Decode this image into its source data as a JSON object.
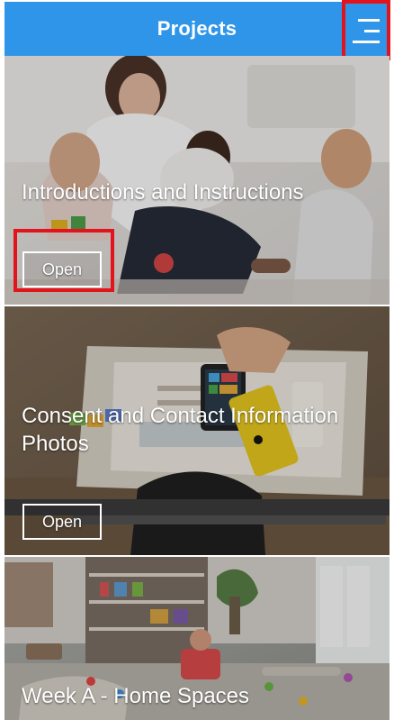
{
  "header": {
    "title": "Projects"
  },
  "cards": [
    {
      "title": "Introductions and Instructions",
      "open_label": "Open"
    },
    {
      "title": "Consent and Contact Information Photos",
      "open_label": "Open"
    },
    {
      "title": "Week A - Home Spaces"
    }
  ],
  "icons": {
    "menu": "menu-icon"
  },
  "colors": {
    "header": "#2f95e8",
    "highlight": "#e3131b",
    "text": "#ffffff"
  }
}
